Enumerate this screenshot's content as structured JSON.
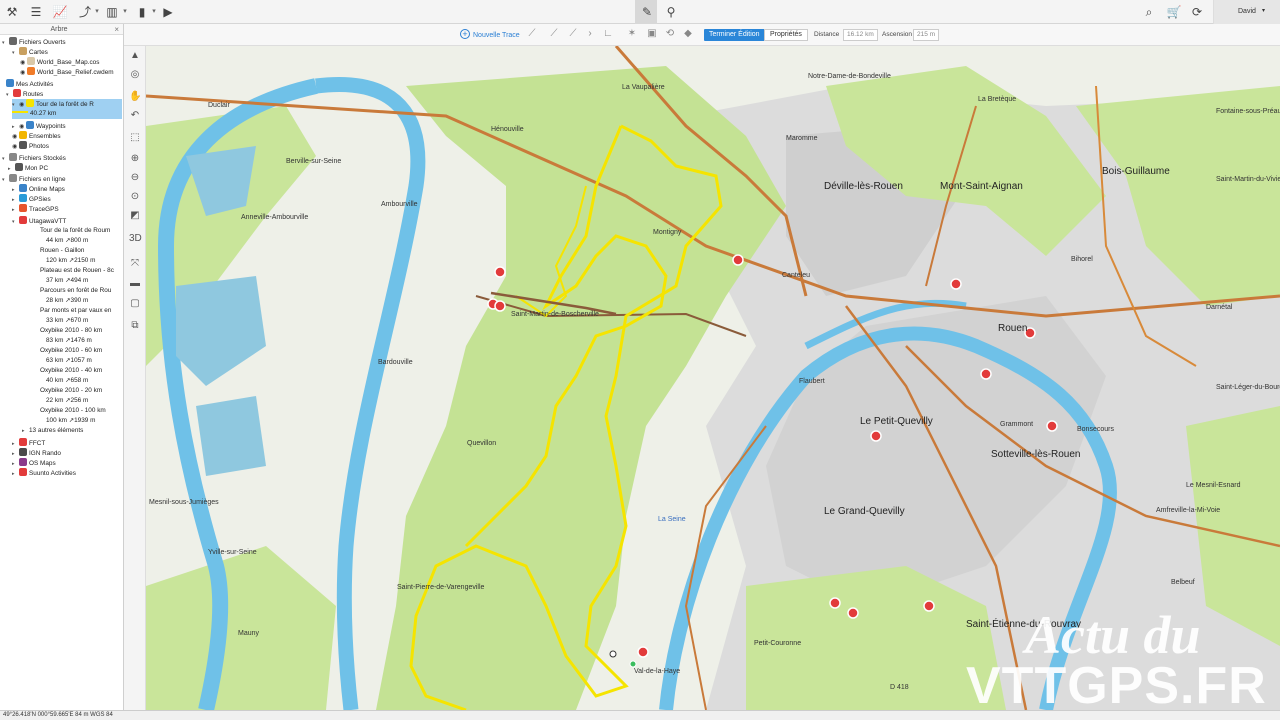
{
  "user": {
    "name": "David"
  },
  "panel": {
    "title": "Arbre",
    "close": "×",
    "rows": [
      {
        "label": "Fichiers Ouverts"
      },
      {
        "label": "Cartes"
      },
      {
        "label": "World_Base_Map.cos"
      },
      {
        "label": "World_Base_Relief.cwdem"
      },
      {
        "label": "Mes Activités"
      },
      {
        "label": "Routes"
      },
      {
        "label": "Tour de la forêt de R"
      },
      {
        "label": "40.27 km"
      },
      {
        "label": "Waypoints"
      },
      {
        "label": "Ensembles"
      },
      {
        "label": "Photos"
      },
      {
        "label": "Fichiers Stockés"
      },
      {
        "label": "Mon PC"
      },
      {
        "label": "Fichiers en ligne"
      },
      {
        "label": "Online Maps"
      },
      {
        "label": "GPSies"
      },
      {
        "label": "TraceGPS"
      },
      {
        "label": "UtagawaVTT"
      },
      {
        "label": "Tour de la forêt de Roum"
      },
      {
        "label": "44 km ↗800 m"
      },
      {
        "label": "Rouen - Gaillon"
      },
      {
        "label": "120 km ↗2150 m"
      },
      {
        "label": "Plateau est de Rouen - 8c"
      },
      {
        "label": "37 km ↗494 m"
      },
      {
        "label": "Parcours en forêt de Rou"
      },
      {
        "label": "28 km ↗390 m"
      },
      {
        "label": "Par monts et par vaux en"
      },
      {
        "label": "33 km ↗670 m"
      },
      {
        "label": "Oxybike 2010 - 80 km"
      },
      {
        "label": "83 km ↗1476 m"
      },
      {
        "label": "Oxybike 2010 - 60 km"
      },
      {
        "label": "63 km ↗1057 m"
      },
      {
        "label": "Oxybike 2010 - 40 km"
      },
      {
        "label": "40 km ↗658 m"
      },
      {
        "label": "Oxybike 2010 - 20 km"
      },
      {
        "label": "22 km ↗256 m"
      },
      {
        "label": "Oxybike 2010 - 100 km"
      },
      {
        "label": "100 km ↗1939 m"
      },
      {
        "label": "13 autres éléments"
      },
      {
        "label": "FFCT"
      },
      {
        "label": "IGN Rando"
      },
      {
        "label": "OS Maps"
      },
      {
        "label": "Suunto Activities"
      }
    ]
  },
  "map_toolbar": {
    "new_trace": "Nouvelle Trace",
    "finish": "Terminer Édition",
    "properties": "Propriétés",
    "distance_label": "Distance",
    "distance_value": "16.12 km",
    "ascent_label": "Ascension",
    "ascent_value": "215 m"
  },
  "map": {
    "places": [
      {
        "name": "Duclair"
      },
      {
        "name": "La Vaupalière"
      },
      {
        "name": "Notre-Dame-de-Bondeville"
      },
      {
        "name": "Hénouville"
      },
      {
        "name": "Maromme"
      },
      {
        "name": "La Bretèque"
      },
      {
        "name": "Fontaine-sous-Préaux"
      },
      {
        "name": "Berville-sur-Seine"
      },
      {
        "name": "Déville-lès-Rouen"
      },
      {
        "name": "Mont-Saint-Aignan"
      },
      {
        "name": "Bois-Guillaume"
      },
      {
        "name": "Saint-Martin-du-Vivier"
      },
      {
        "name": "Anneville-Ambourville"
      },
      {
        "name": "Ambourville"
      },
      {
        "name": "Montigny"
      },
      {
        "name": "Canteleu"
      },
      {
        "name": "Bihorel"
      },
      {
        "name": "Saint-Martin-de-Boscherville"
      },
      {
        "name": "Rouen"
      },
      {
        "name": "Darnétal"
      },
      {
        "name": "Bardouville"
      },
      {
        "name": "Flaubert"
      },
      {
        "name": "Saint-Léger-du-Bourg-Denis"
      },
      {
        "name": "Le Petit-Quevilly"
      },
      {
        "name": "Grammont"
      },
      {
        "name": "Bonsecours"
      },
      {
        "name": "Sotteville-lès-Rouen"
      },
      {
        "name": "Quevillon"
      },
      {
        "name": "Le Mesnil-Esnard"
      },
      {
        "name": "Mesnil-sous-Jumièges"
      },
      {
        "name": "Le Grand-Quevilly"
      },
      {
        "name": "Amfreville-la-Mi-Voie"
      },
      {
        "name": "La Seine"
      },
      {
        "name": "Yville-sur-Seine"
      },
      {
        "name": "Belbeuf"
      },
      {
        "name": "Saint-Pierre-de-Varengeville"
      },
      {
        "name": "Saint-Étienne-du-Rouvray"
      },
      {
        "name": "Mauny"
      },
      {
        "name": "Petit-Couronne"
      },
      {
        "name": "Val-de-la-Haye"
      },
      {
        "name": "D 418"
      }
    ]
  },
  "status_bar": {
    "text": "49°26.418'N 000°59.665'E  84 m  WGS 84"
  },
  "watermark": {
    "line1": "Actu du",
    "line2": "VTTGPS.FR"
  },
  "colors": {
    "accent": "#2a86d8",
    "track": "#f5e400",
    "forest": "#c9e59a",
    "river": "#6fc1e8"
  }
}
